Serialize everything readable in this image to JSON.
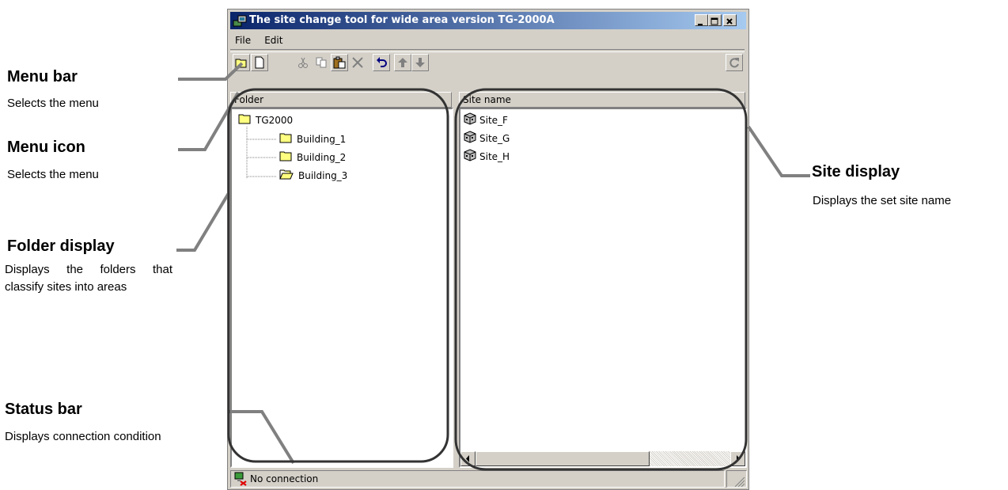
{
  "window": {
    "title": "The site change tool for wide area version TG-2000A",
    "controls": [
      "minimize",
      "maximize",
      "close"
    ]
  },
  "menubar": {
    "items": [
      "File",
      "Edit"
    ]
  },
  "toolbar": {
    "buttons": [
      "open-folder-icon",
      "new-document-icon",
      "cut-icon",
      "copy-icon",
      "paste-icon",
      "delete-icon",
      "undo-icon",
      "move-up-icon",
      "move-down-icon",
      "refresh-icon"
    ]
  },
  "folder_pane": {
    "header": "Folder",
    "root": "TG2000",
    "children": [
      "Building_1",
      "Building_2",
      "Building_3"
    ]
  },
  "site_pane": {
    "header": "Site name",
    "sites": [
      "Site_F",
      "Site_G",
      "Site_H"
    ]
  },
  "statusbar": {
    "text": "No connection"
  },
  "annotations": {
    "menu_bar": {
      "title": "Menu bar",
      "desc": "Selects the menu"
    },
    "menu_icon": {
      "title": "Menu icon",
      "desc": "Selects the menu"
    },
    "folder_display": {
      "title": "Folder display",
      "desc": "Displays the folders that classify sites into areas"
    },
    "status_bar": {
      "title": "Status bar",
      "desc": "Displays connection condition"
    },
    "site_display": {
      "title": "Site display",
      "desc": "Displays the set site name"
    }
  },
  "colors": {
    "titlebar_start": "#0a246a",
    "titlebar_end": "#a6caf0",
    "window_face": "#d4d0c8",
    "callout_line": "#808080",
    "highlight_outline": "#333333",
    "folder_yellow": "#ffff80"
  }
}
